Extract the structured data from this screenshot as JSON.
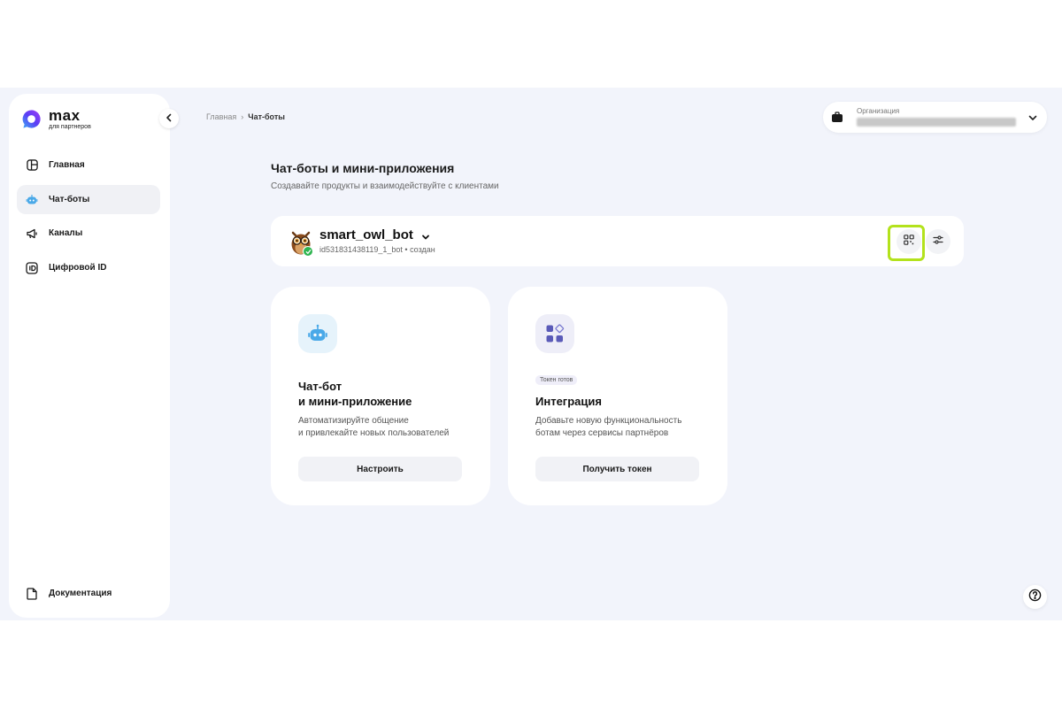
{
  "logo": {
    "name": "max",
    "subtitle": "для партнеров",
    "accent": "#5b3df5"
  },
  "sidebar": {
    "items": [
      {
        "label": "Главная",
        "icon": "dashboard-icon"
      },
      {
        "label": "Чат-боты",
        "icon": "robot-icon",
        "active": true
      },
      {
        "label": "Каналы",
        "icon": "megaphone-icon"
      },
      {
        "label": "Цифровой ID",
        "icon": "id-icon"
      }
    ],
    "footer": {
      "label": "Документация",
      "icon": "document-icon"
    }
  },
  "breadcrumb": {
    "home": "Главная",
    "separator": "›",
    "current": "Чат-боты"
  },
  "org": {
    "label": "Организация"
  },
  "page": {
    "title": "Чат-боты и мини-приложения",
    "subtitle": "Создавайте продукты и взаимодействуйте с клиентами"
  },
  "bot": {
    "name": "smart_owl_bot",
    "id_status": "id531831438119_1_bot • создан",
    "status_color": "#2fb551"
  },
  "cards": [
    {
      "title_line1": "Чат-бот",
      "title_line2": "и мини-приложение",
      "desc_line1": "Автоматизируйте общение",
      "desc_line2": "и привлекайте новых пользователей",
      "button": "Настроить"
    },
    {
      "badge": "Токен готов",
      "title_line1": "Интеграция",
      "desc_line1": "Добавьте новую функциональность",
      "desc_line2": "ботам через сервисы партнёров",
      "button": "Получить токен"
    }
  ],
  "highlight_color": "#b3e21c"
}
